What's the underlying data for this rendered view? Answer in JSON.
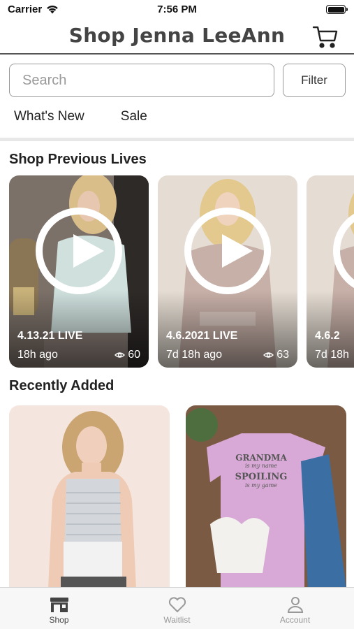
{
  "status": {
    "carrier": "Carrier",
    "time": "7:56 PM"
  },
  "header": {
    "title": "Shop Jenna LeeAnn"
  },
  "search": {
    "placeholder": "Search",
    "filter_label": "Filter"
  },
  "categories": [
    "What's New",
    "Sale"
  ],
  "sections": {
    "previous_lives": "Shop Previous Lives",
    "recently_added": "Recently Added"
  },
  "lives": [
    {
      "label": "4.13.21 LIVE",
      "ago": "18h ago",
      "views": "60"
    },
    {
      "label": "4.6.2021 LIVE",
      "ago": "7d 18h ago",
      "views": "63"
    },
    {
      "label": "4.6.2",
      "ago": "7d 18h",
      "views": ""
    }
  ],
  "products": [
    {
      "image": "grey-striped-tank-top"
    },
    {
      "image": "pink-grandma-tshirt",
      "shirt_print": [
        "GRANDMA",
        "is my name",
        "SPOILING",
        "is my game"
      ]
    }
  ],
  "tabbar": {
    "items": [
      "Shop",
      "Waitlist",
      "Account"
    ],
    "active": "Shop"
  },
  "colors": {
    "accent": "#444444",
    "tab_inactive": "#999999"
  }
}
